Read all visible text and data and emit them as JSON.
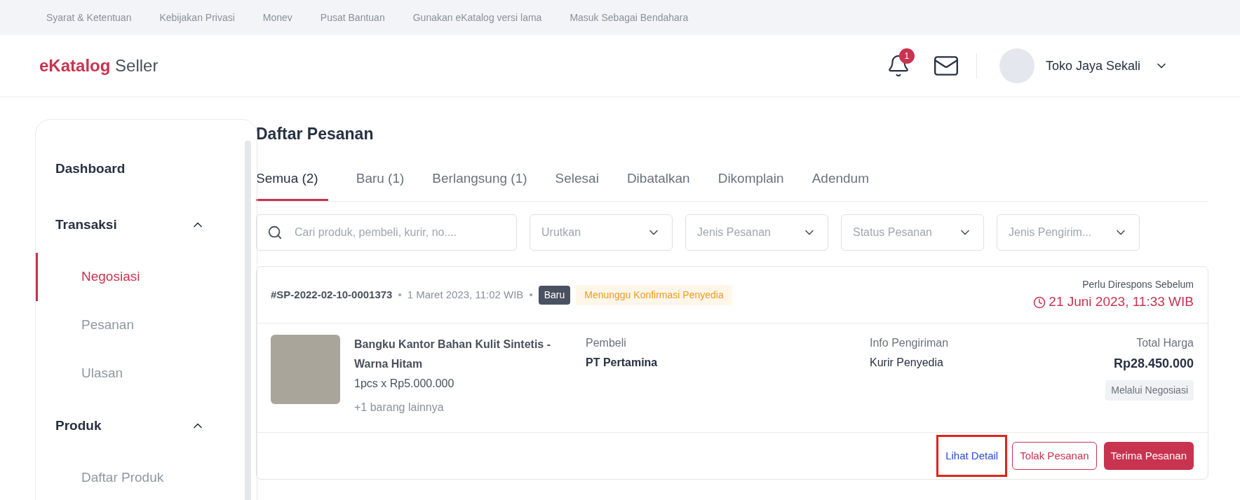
{
  "top_links": [
    "Syarat & Ketentuan",
    "Kebijakan Privasi",
    "Monev",
    "Pusat Bantuan",
    "Gunakan eKatalog versi lama",
    "Masuk Sebagai Bendahara"
  ],
  "header": {
    "logo_mark": "e",
    "logo_name": "Katalog",
    "logo_suffix": "Seller",
    "notification_count": "1",
    "user_name": "Toko Jaya Sekali"
  },
  "sidebar": {
    "items": [
      {
        "label": "Dashboard"
      },
      {
        "label": "Transaksi",
        "expanded": true,
        "children": [
          {
            "label": "Negosiasi",
            "selected": true
          },
          {
            "label": "Pesanan",
            "selected": false
          },
          {
            "label": "Ulasan",
            "selected": false
          }
        ]
      },
      {
        "label": "Produk",
        "expanded": true,
        "children": [
          {
            "label": "Daftar Produk",
            "selected": false
          }
        ]
      }
    ]
  },
  "page_title": "Daftar Pesanan",
  "tabs": [
    {
      "label": "Semua (2)",
      "selected": true
    },
    {
      "label": "Baru (1)",
      "selected": false
    },
    {
      "label": "Berlangsung (1)",
      "selected": false
    },
    {
      "label": "Selesai",
      "selected": false
    },
    {
      "label": "Dibatalkan",
      "selected": false
    },
    {
      "label": "Dikomplain",
      "selected": false
    },
    {
      "label": "Adendum",
      "selected": false
    }
  ],
  "search": {
    "placeholder": "Cari produk, pembeli, kurir, no...."
  },
  "filters": [
    {
      "placeholder": "Urutkan"
    },
    {
      "placeholder": "Jenis Pesanan"
    },
    {
      "placeholder": "Status Pesanan"
    },
    {
      "placeholder": "Jenis Pengirim..."
    }
  ],
  "orders": [
    {
      "number": "#SP-2022-02-10-0001373",
      "separator": "•",
      "date": "1 Maret 2023, 11:02 WIB",
      "badge": "Baru",
      "status": "Menunggu Konfirmasi Penyedia",
      "deadline_label": "Perlu Direspons Sebelum",
      "deadline": "21 Juni 2023, 11:33 WIB",
      "product_name": "Bangku Kantor Bahan Kulit Sintetis - Warna Hitam",
      "quantity_price": "1pcs x Rp5.000.000",
      "more_items": "+1 barang lainnya",
      "buyer_label": "Pembeli",
      "buyer": "PT Pertamina",
      "shipping_label": "Info Pengiriman",
      "shipping": "Kurir Penyedia",
      "total_label": "Total Harga",
      "total": "Rp28.450.000",
      "method": "Melalui Negosiasi",
      "actions": [
        {
          "label": "Lihat Detail",
          "kind": "link",
          "highlighted": true
        },
        {
          "label": "Tolak Pesanan",
          "kind": "outline",
          "highlighted": false
        },
        {
          "label": "Terima Pesanan",
          "kind": "primary",
          "highlighted": false
        }
      ]
    }
  ]
}
